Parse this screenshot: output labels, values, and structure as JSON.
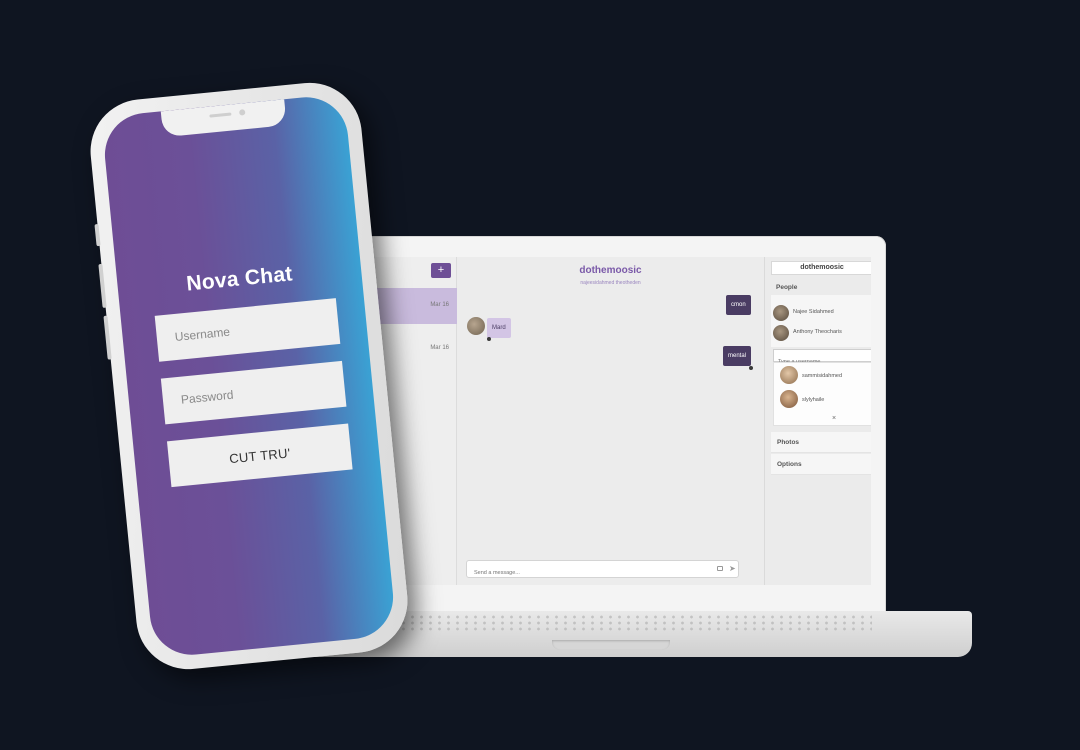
{
  "login": {
    "app_title": "Nova Chat",
    "username_placeholder": "Username",
    "password_placeholder": "Password",
    "submit_label": "CUT TRU'"
  },
  "sidebar": {
    "new_button": "+",
    "conversations": [
      {
        "date": "Mar 16",
        "active": true
      },
      {
        "date": "Mar 16",
        "active": false
      }
    ]
  },
  "chat": {
    "title": "dothemoosic",
    "subtitle": "najeesidahmed theotheden",
    "messages": [
      {
        "text": "cmon",
        "direction": "out"
      },
      {
        "text": "Mard",
        "direction": "in"
      },
      {
        "text": "mental",
        "direction": "out"
      }
    ],
    "composer_placeholder": "Send a message..."
  },
  "details": {
    "title": "dothemoosic",
    "people_label": "People",
    "people": [
      "Najee Sidahmed",
      "Anthony Theocharis"
    ],
    "search_placeholder": "Type a username",
    "suggestions": [
      "sammisidahmed",
      "slylyhaile"
    ],
    "close_symbol": "×",
    "photos_label": "Photos",
    "options_label": "Options"
  },
  "colors": {
    "background": "#0f1521",
    "accent": "#6e4f96",
    "bubble_out": "#4a3c63",
    "bubble_in": "#d3c5e5",
    "gradient_start": "#6e4d95",
    "gradient_end": "#3aa2d4"
  }
}
